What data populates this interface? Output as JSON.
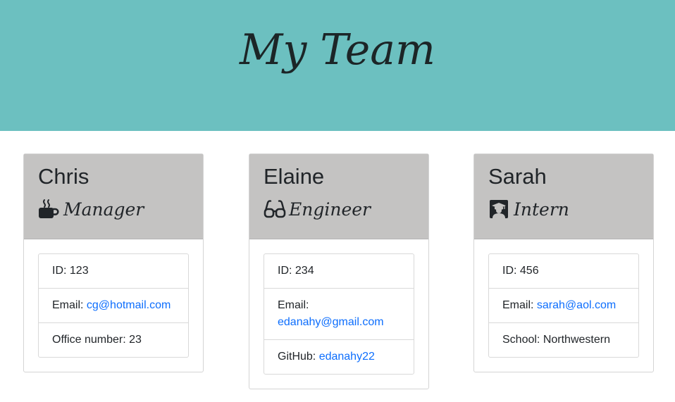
{
  "header": {
    "title": "My Team"
  },
  "colors": {
    "header_bg": "#6cc0c0",
    "card_header_bg": "#c4c3c2",
    "link": "#0d6efd"
  },
  "team": [
    {
      "name": "Chris",
      "role": "Manager",
      "icon": "mug-icon",
      "id_label": "ID: 123",
      "email_prefix": "Email: ",
      "email": "cg@hotmail.com",
      "extra_prefix": "Office number: 23",
      "extra_link": ""
    },
    {
      "name": "Elaine",
      "role": "Engineer",
      "icon": "glasses-icon",
      "id_label": "ID: 234",
      "email_prefix": "Email: ",
      "email": "edanahy@gmail.com",
      "extra_prefix": "GitHub: ",
      "extra_link": "edanahy22"
    },
    {
      "name": "Sarah",
      "role": "Intern",
      "icon": "graduate-icon",
      "id_label": "ID: 456",
      "email_prefix": "Email: ",
      "email": "sarah@aol.com",
      "extra_prefix": "School: Northwestern",
      "extra_link": ""
    }
  ]
}
